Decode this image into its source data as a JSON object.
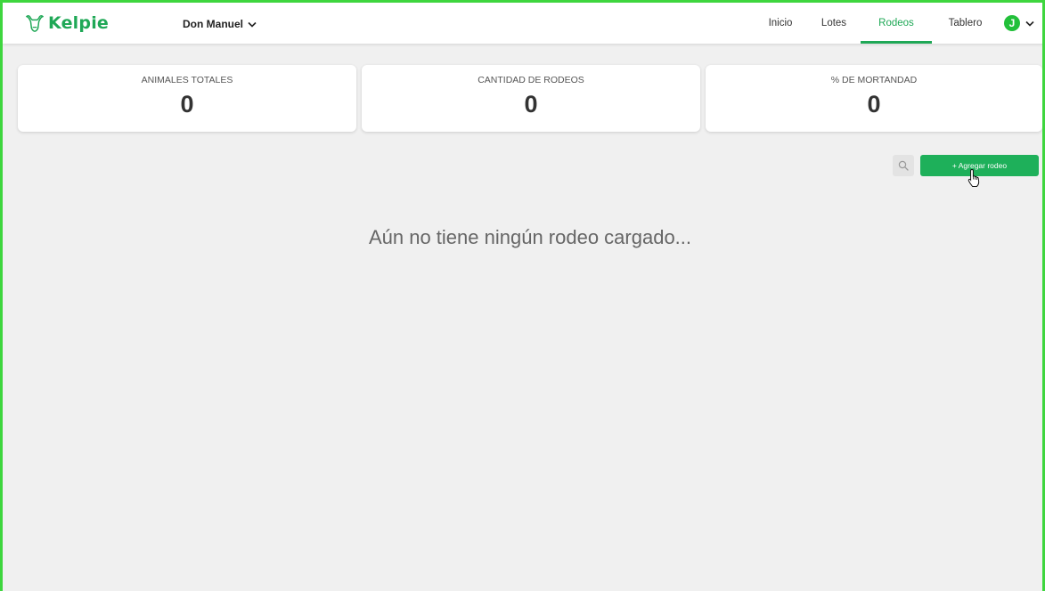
{
  "header": {
    "brand": "Kelpie",
    "farm_selector": "Don Manuel",
    "nav": [
      "Inicio",
      "Lotes",
      "Rodeos",
      "Tablero"
    ],
    "active_tab": "Rodeos",
    "user_initial": "J"
  },
  "stats": [
    {
      "label": "ANIMALES TOTALES",
      "value": "0"
    },
    {
      "label": "CANTIDAD DE RODEOS",
      "value": "0"
    },
    {
      "label": "% DE MORTANDAD",
      "value": "0"
    }
  ],
  "toolbar": {
    "add_label": "+ Agregar rodeo"
  },
  "empty_message": "Aún no tiene ningún rodeo cargado...",
  "colors": {
    "brand": "#1fa856",
    "button": "#1eb05a",
    "avatar": "#22c03a",
    "background": "#f0f0f0",
    "window_border": "#3ed63e"
  },
  "icons": {
    "logo": "cow-head-icon",
    "farm_dropdown": "chevron-down-icon",
    "user_dropdown": "chevron-down-icon",
    "search": "search-icon",
    "cursor": "hand-pointer-icon"
  }
}
